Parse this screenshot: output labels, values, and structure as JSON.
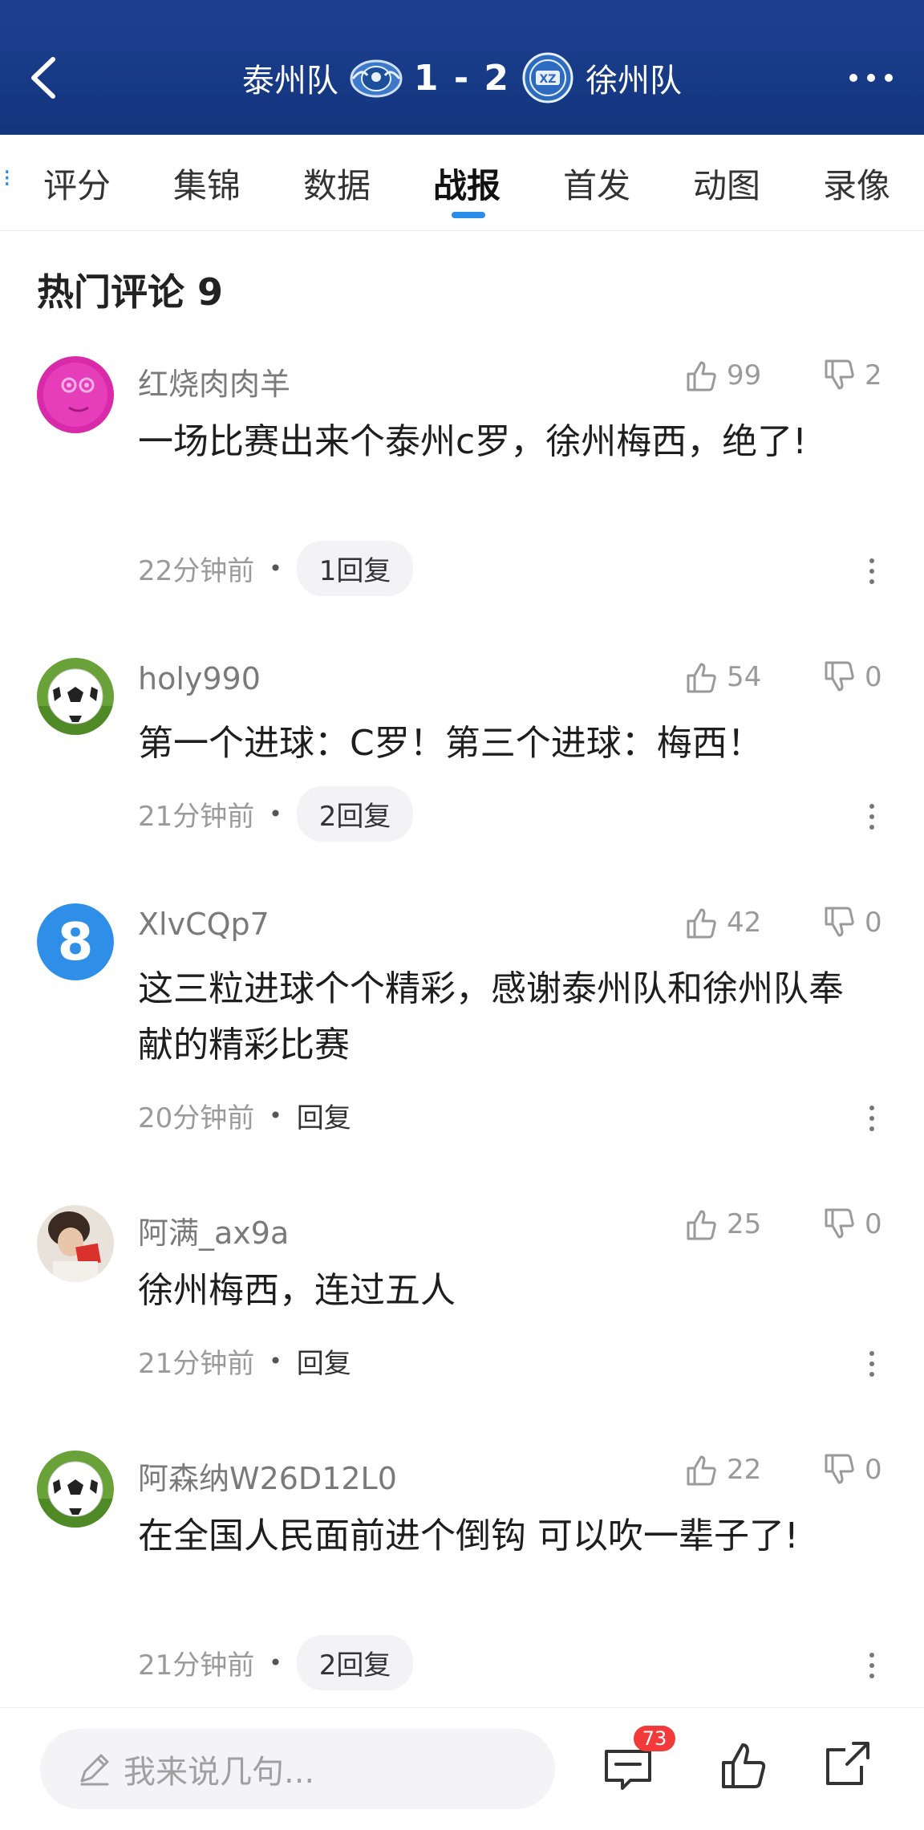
{
  "header": {
    "home_team": "泰州队",
    "score": "1 - 2",
    "away_team": "徐州队",
    "colors": {
      "background": "#173a86"
    }
  },
  "tabs": {
    "items": [
      {
        "label": "评分"
      },
      {
        "label": "集锦"
      },
      {
        "label": "数据"
      },
      {
        "label": "战报",
        "active": true
      },
      {
        "label": "首发"
      },
      {
        "label": "动图"
      },
      {
        "label": "录像"
      }
    ],
    "accent": "#2a8be8"
  },
  "section": {
    "title": "热门评论 9"
  },
  "comments": [
    {
      "avatar_icon": "pink-face-avatar",
      "username": "红烧肉肉羊",
      "likes": "99",
      "dislikes": "2",
      "text": "一场比赛出来个泰州c罗，徐州梅西，绝了!",
      "time": "22分钟前",
      "reply": "1回复"
    },
    {
      "avatar_icon": "soccer-ball-avatar",
      "username": "holy990",
      "likes": "54",
      "dislikes": "0",
      "text": "第一个进球：C罗！第三个进球：梅西！",
      "time": "21分钟前",
      "reply": "2回复"
    },
    {
      "avatar_icon": "number-eight-avatar",
      "username": "XlvCQp7",
      "likes": "42",
      "dislikes": "0",
      "text": "这三粒进球个个精彩，感谢泰州队和徐州队奉献的精彩比赛",
      "time": "20分钟前",
      "reply": "回复"
    },
    {
      "avatar_icon": "person-photo-avatar",
      "username": "阿满_ax9a",
      "likes": "25",
      "dislikes": "0",
      "text": "徐州梅西，连过五人",
      "time": "21分钟前",
      "reply": "回复"
    },
    {
      "avatar_icon": "soccer-ball-avatar",
      "username": "阿森纳W26D12L0",
      "likes": "22",
      "dislikes": "0",
      "text": "在全国人民面前进个倒钩 可以吹一辈子了!",
      "time": "21分钟前",
      "reply": "2回复"
    }
  ],
  "bottom_bar": {
    "placeholder": "我来说几句...",
    "comment_count": "73"
  }
}
